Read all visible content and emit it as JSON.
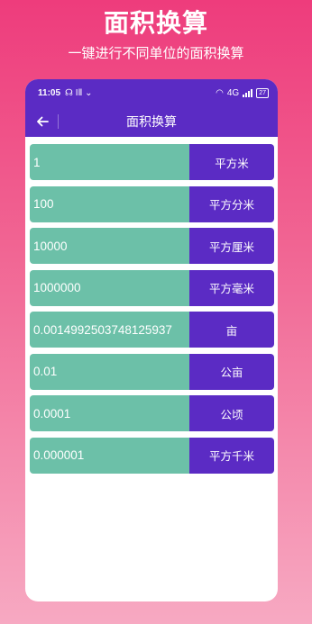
{
  "promo": {
    "title": "面积换算",
    "subtitle": "一键进行不同单位的面积换算"
  },
  "status_bar": {
    "time": "11:05",
    "left_icons": "☊ IⅡ ⌄",
    "network": "4G",
    "battery": "27"
  },
  "app_bar": {
    "title": "面积换算",
    "back_icon": "arrow-left-icon"
  },
  "rows": [
    {
      "value": "1",
      "unit": "平方米"
    },
    {
      "value": "100",
      "unit": "平方分米"
    },
    {
      "value": "10000",
      "unit": "平方厘米"
    },
    {
      "value": "1000000",
      "unit": "平方毫米"
    },
    {
      "value": "0.0014992503748125937",
      "unit": "亩"
    },
    {
      "value": "0.01",
      "unit": "公亩"
    },
    {
      "value": "0.0001",
      "unit": "公顷"
    },
    {
      "value": "0.000001",
      "unit": "平方千米"
    }
  ],
  "colors": {
    "accent": "#5b2bc4",
    "value_bg": "#6cc0a8",
    "background_top": "#ee3c7c"
  }
}
